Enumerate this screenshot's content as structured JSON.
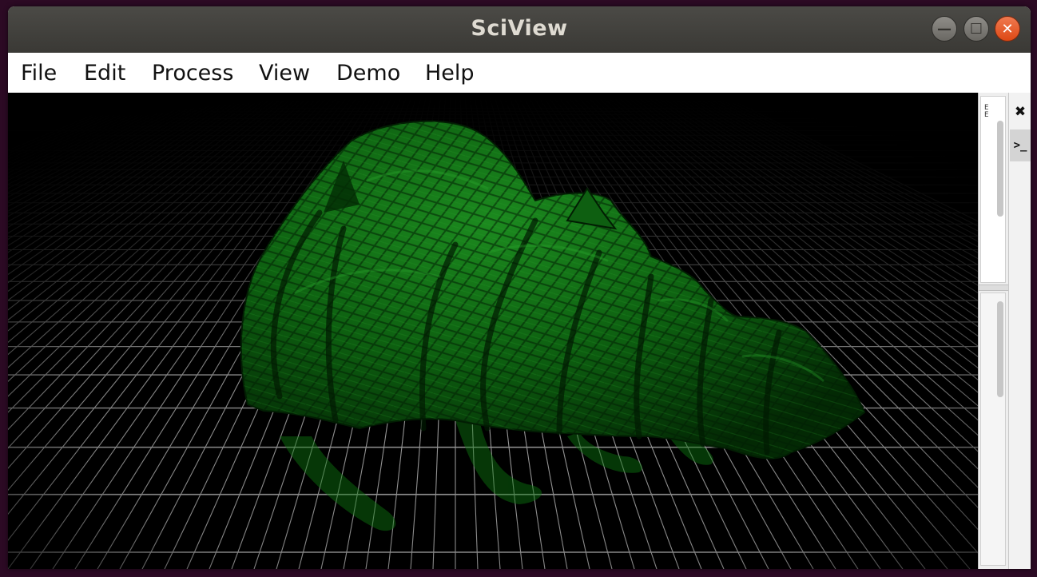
{
  "window": {
    "title": "SciView",
    "controls": {
      "minimize_icon": "minimize-icon",
      "maximize_icon": "maximize-icon",
      "close_icon": "close-icon",
      "minimize_glyph": "—",
      "maximize_glyph": "☐",
      "close_glyph": "✕"
    }
  },
  "menu": {
    "items": [
      {
        "label": "File"
      },
      {
        "label": "Edit"
      },
      {
        "label": "Process"
      },
      {
        "label": "View"
      },
      {
        "label": "Demo"
      },
      {
        "label": "Help"
      }
    ]
  },
  "viewport": {
    "scene": "green mesh on wireframe floor grid",
    "background_color": "#000000",
    "grid_color": "#9a9a9a",
    "mesh_color": "#0f6b12"
  },
  "side_panel": {
    "mini_label": "E\nE"
  },
  "tool_strip": {
    "tabs": [
      {
        "icon": "wrench-screwdriver-icon",
        "glyph": "✖"
      },
      {
        "icon": "console-icon",
        "glyph": ">_"
      }
    ]
  }
}
